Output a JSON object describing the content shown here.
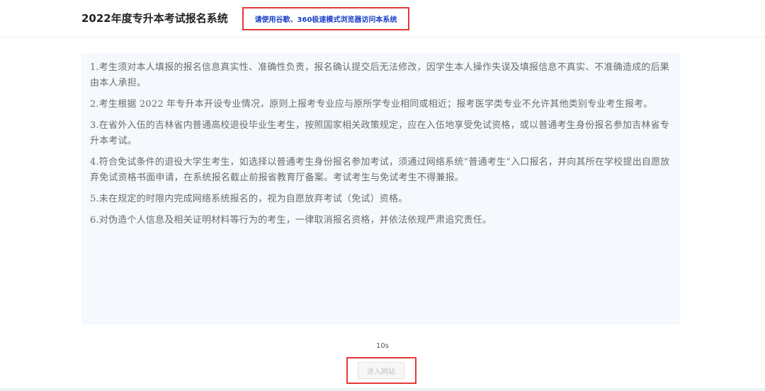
{
  "header": {
    "title": "2022年度专升本考试报名系统",
    "browser_notice": "请使用谷歌、360极速模式浏览器访问本系统"
  },
  "notice": {
    "items": [
      "1.考生须对本人填报的报名信息真实性、准确性负责，报名确认提交后无法修改，因学生本人操作失误及填报信息不真实、不准确造成的后果由本人承担。",
      "2.考生根据 2022 年专升本开设专业情况，原则上报考专业应与原所学专业相同或相近；报考医学类专业不允许其他类别专业考生报考。",
      "3.在省外入伍的吉林省内普通高校退役毕业生考生，按照国家相关政策规定，应在入伍地享受免试资格，或以普通考生身份报名参加吉林省专升本考试。",
      "4.符合免试条件的退役大学生考生，如选择以普通考生身份报名参加考试，须通过网络系统“普通考生”入口报名，并向其所在学校提出自愿放弃免试资格书面申请，在系统报名截止前报省教育厅备案。考试考生与免试考生不得兼报。",
      "5.未在规定的时限内完成网络系统报名的，视为自愿放弃考试（免试）资格。",
      "6.对伪造个人信息及相关证明材料等行为的考生，一律取消报名资格，并依法依规严肃追究责任。"
    ]
  },
  "countdown": "10s",
  "enter_button": "进入网站",
  "colors": {
    "highlight_border": "#e53935",
    "notice_text": "#1a3fc7",
    "panel_bg": "#f5f8fc"
  }
}
